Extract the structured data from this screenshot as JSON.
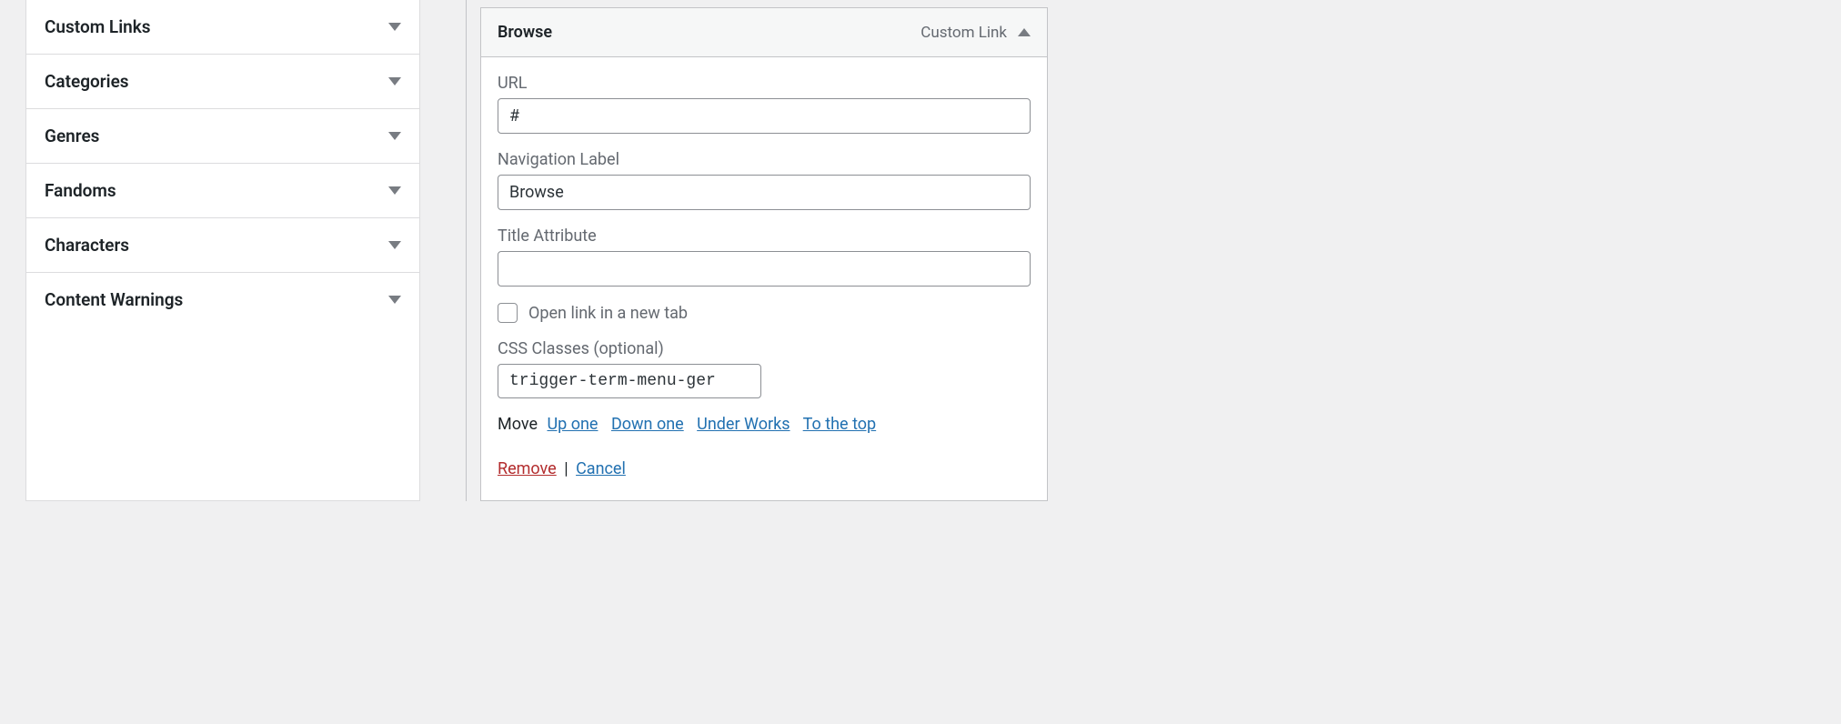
{
  "sidebar": {
    "items": [
      {
        "label": "Custom Links"
      },
      {
        "label": "Categories"
      },
      {
        "label": "Genres"
      },
      {
        "label": "Fandoms"
      },
      {
        "label": "Characters"
      },
      {
        "label": "Content Warnings"
      }
    ]
  },
  "menu_item": {
    "title": "Browse",
    "type_label": "Custom Link",
    "fields": {
      "url": {
        "label": "URL",
        "value": "#"
      },
      "nav_label": {
        "label": "Navigation Label",
        "value": "Browse"
      },
      "title_attr": {
        "label": "Title Attribute",
        "value": ""
      },
      "new_tab": {
        "label": "Open link in a new tab",
        "checked": false
      },
      "css_classes": {
        "label": "CSS Classes (optional)",
        "value": "trigger-term-menu-ger"
      }
    },
    "move": {
      "label": "Move",
      "up_one": "Up one",
      "down_one": "Down one",
      "under": "Under Works",
      "to_top": "To the top"
    },
    "actions": {
      "remove": "Remove",
      "cancel": "Cancel"
    }
  }
}
